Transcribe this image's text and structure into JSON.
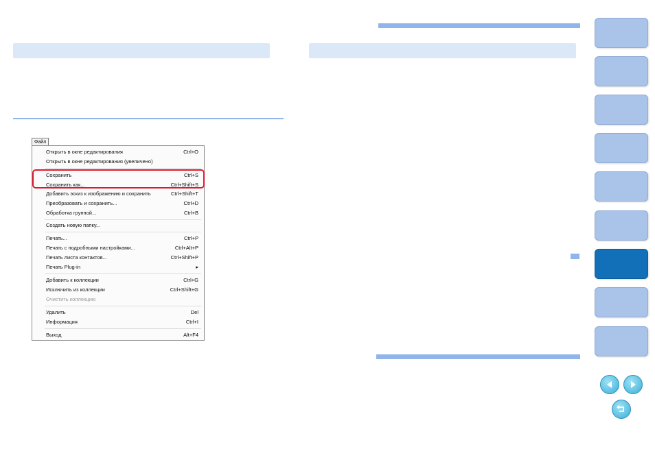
{
  "menu": {
    "title": "Файл",
    "items": [
      {
        "label": "Открыть в окне редактирования",
        "shortcut": "Ctrl+O"
      },
      {
        "label": "Открыть в окне редактирования (увеличено)",
        "shortcut": ""
      },
      {
        "label": "Сохранить",
        "shortcut": "Ctrl+S"
      },
      {
        "label": "Сохранить как...",
        "shortcut": "Ctrl+Shift+S"
      },
      {
        "label": "Добавить эскиз к изображению и сохранить",
        "shortcut": "Ctrl+Shift+T"
      },
      {
        "label": "Преобразовать и сохранить...",
        "shortcut": "Ctrl+D"
      },
      {
        "label": "Обработка группой...",
        "shortcut": "Ctrl+B"
      },
      {
        "label": "Создать новую папку...",
        "shortcut": ""
      },
      {
        "label": "Печать...",
        "shortcut": "Ctrl+P"
      },
      {
        "label": "Печать с подробными настройками...",
        "shortcut": "Ctrl+Alt+P"
      },
      {
        "label": "Печать листа контактов...",
        "shortcut": "Ctrl+Shift+P"
      },
      {
        "label": "Печать Plug-in",
        "shortcut": "▸"
      },
      {
        "label": "Добавить к коллекции",
        "shortcut": "Ctrl+G"
      },
      {
        "label": "Исключить из коллекции",
        "shortcut": "Ctrl+Shift+G"
      },
      {
        "label": "Очистить коллекцию",
        "shortcut": ""
      },
      {
        "label": "Удалить",
        "shortcut": "Del"
      },
      {
        "label": "Информация",
        "shortcut": "Ctrl+I"
      },
      {
        "label": "Выход",
        "shortcut": "Alt+F4"
      }
    ]
  },
  "icons": {
    "prev": "arrow-left-icon",
    "next": "arrow-right-icon",
    "back": "return-icon"
  },
  "colors": {
    "accent_bar": "#8fb5ea",
    "section_bar": "#dbe8f8",
    "tab": "#aac3e8",
    "tab_active": "#1270b8",
    "highlight": "#e0182d"
  }
}
